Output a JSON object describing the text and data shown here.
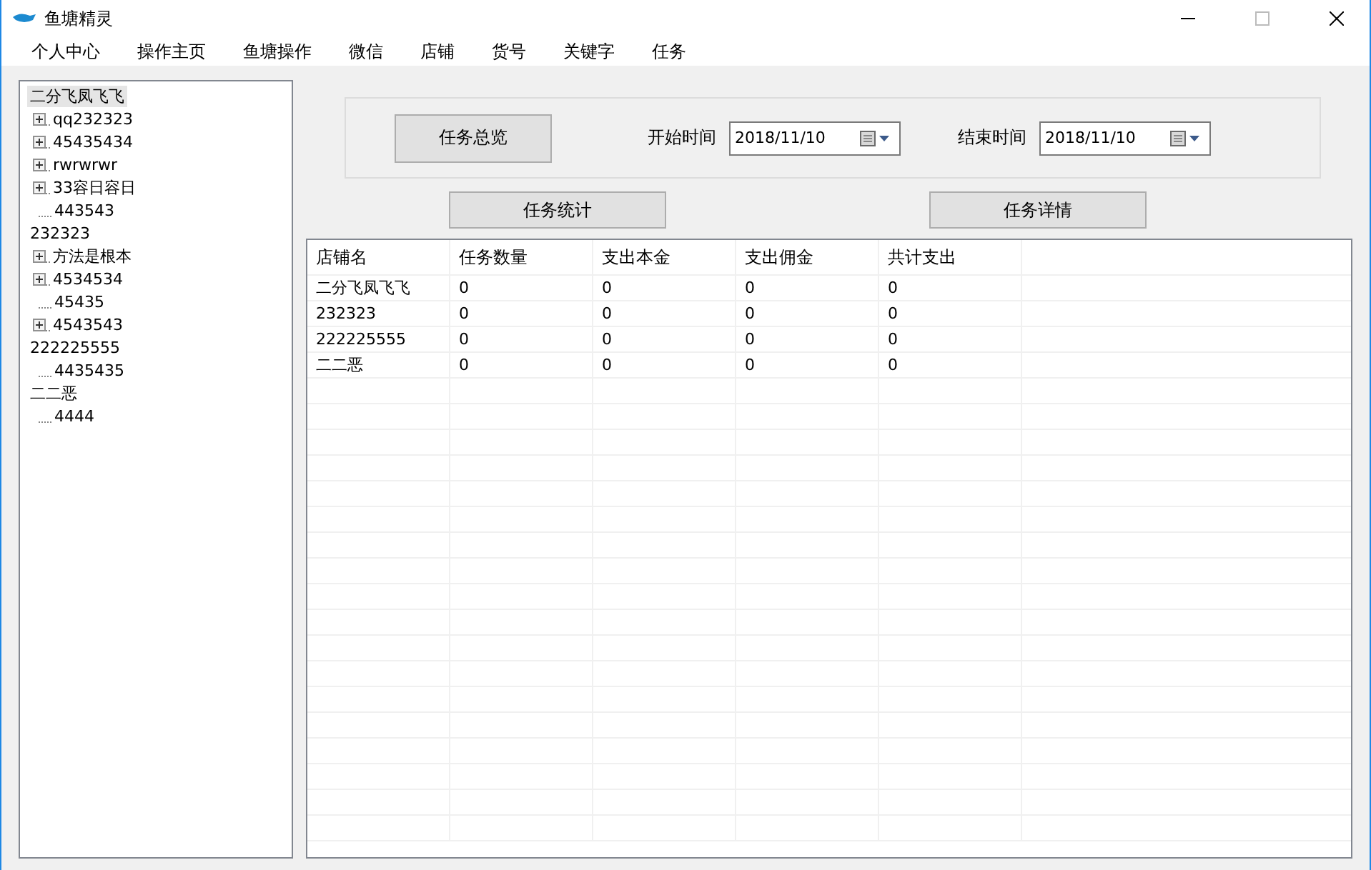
{
  "window": {
    "title": "鱼塘精灵"
  },
  "menu": [
    {
      "label": "个人中心"
    },
    {
      "label": "操作主页"
    },
    {
      "label": "鱼塘操作"
    },
    {
      "label": "微信"
    },
    {
      "label": "店铺"
    },
    {
      "label": "货号"
    },
    {
      "label": "关键字"
    },
    {
      "label": "任务"
    }
  ],
  "tree": [
    {
      "label": "二分飞凤飞飞",
      "selected": true,
      "children": [
        {
          "label": "qq232323",
          "selected": false,
          "expanded": false
        },
        {
          "label": "45435434",
          "selected": false,
          "expanded": false
        },
        {
          "label": "rwrwrwr",
          "selected": false,
          "expanded": false
        },
        {
          "label": "33容日容日",
          "selected": false,
          "expanded": false
        },
        {
          "label": "443543",
          "selected": false
        }
      ]
    },
    {
      "label": "232323",
      "selected": false,
      "children": [
        {
          "label": "方法是根本",
          "selected": false,
          "expanded": false
        },
        {
          "label": "4534534",
          "selected": false,
          "expanded": false
        },
        {
          "label": "45435",
          "selected": false
        },
        {
          "label": "4543543",
          "selected": false,
          "expanded": false
        }
      ]
    },
    {
      "label": "222225555",
      "selected": false,
      "children": [
        {
          "label": "4435435",
          "selected": false
        }
      ]
    },
    {
      "label": "二二恶",
      "selected": false,
      "children": [
        {
          "label": "4444",
          "selected": false
        }
      ]
    }
  ],
  "filter": {
    "overview_button": "任务总览",
    "start_label": "开始时间",
    "start_date": "2018/11/10",
    "end_label": "结束时间",
    "end_date": "2018/11/10"
  },
  "actions": [
    "任务统计",
    "任务详情"
  ],
  "table": {
    "columns": [
      "店铺名",
      "任务数量",
      "支出本金",
      "支出佣金",
      "共计支出"
    ],
    "rows": [
      [
        "二分飞凤飞飞",
        "0",
        "0",
        "0",
        "0"
      ],
      [
        "232323",
        "0",
        "0",
        "0",
        "0"
      ],
      [
        "222225555",
        "0",
        "0",
        "0",
        "0"
      ],
      [
        "二二恶",
        "0",
        "0",
        "0",
        "0"
      ]
    ]
  }
}
